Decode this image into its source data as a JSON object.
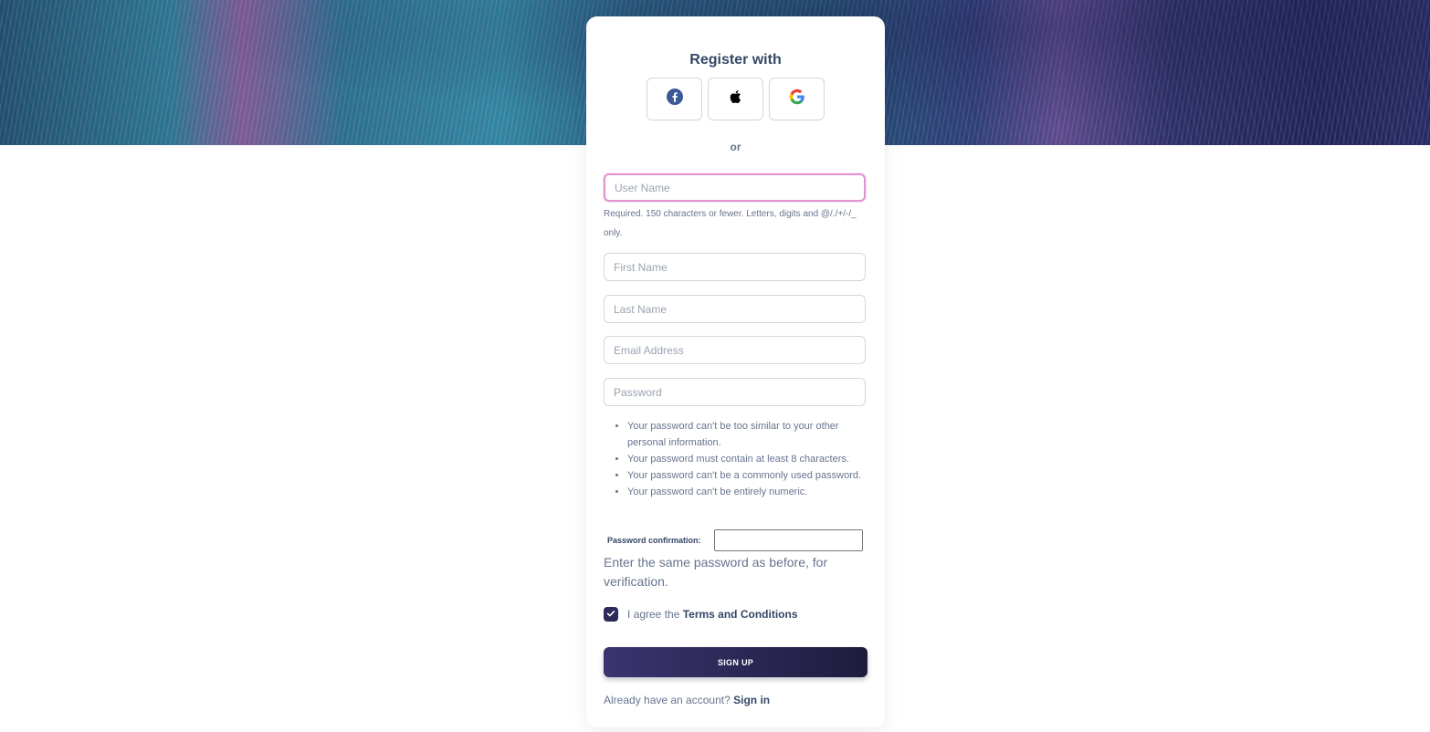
{
  "form": {
    "title": "Register with",
    "social": [
      {
        "name": "facebook-icon"
      },
      {
        "name": "apple-icon"
      },
      {
        "name": "google-icon"
      }
    ],
    "separator": "or",
    "fields": {
      "username_placeholder": "User Name",
      "username_help": "Required. 150 characters or fewer. Letters, digits and @/./+/-/_ only.",
      "first_name_placeholder": "First Name",
      "last_name_placeholder": "Last Name",
      "email_placeholder": "Email Address",
      "password_placeholder": "Password"
    },
    "password_rules": [
      "Your password can't be too similar to your other personal information.",
      "Your password must contain at least 8 characters.",
      "Your password can't be a commonly used password.",
      "Your password can't be entirely numeric."
    ],
    "confirmation_label": "Password confirmation:",
    "confirmation_help": "Enter the same password as before, for verification.",
    "terms": {
      "prefix": "I agree the ",
      "link": "Terms and Conditions",
      "checked": true
    },
    "submit_label": "SIGN UP",
    "signin": {
      "prefix": "Already have an account? ",
      "link": "Sign in"
    }
  },
  "colors": {
    "primary_dark": "#2c2a59",
    "focus_border": "#e293d3",
    "text_heading": "#344767",
    "text_body": "#67748e"
  }
}
